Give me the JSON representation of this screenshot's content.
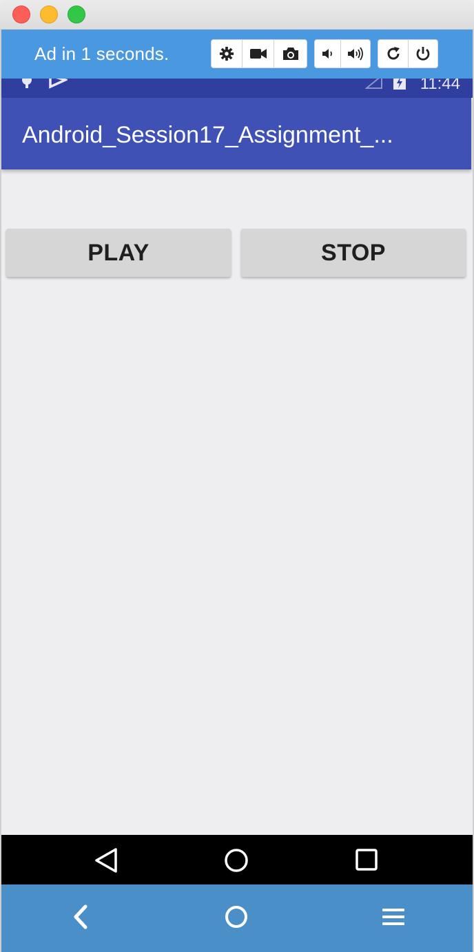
{
  "window": {
    "controls": [
      "close",
      "minimize",
      "zoom"
    ]
  },
  "toolbar": {
    "ad_text": "Ad in 1 seconds.",
    "buttons": [
      "gear-icon",
      "video-icon",
      "camera-icon",
      "volume-down-icon",
      "volume-up-icon",
      "rotate-icon",
      "power-icon"
    ]
  },
  "statusbar": {
    "time": "11:44"
  },
  "app": {
    "title": "Android_Session17_Assignment_...",
    "play_label": "PLAY",
    "stop_label": "STOP"
  },
  "android_nav": [
    "back-triangle-icon",
    "home-circle-icon",
    "recents-square-icon"
  ],
  "bottom_nav": [
    "chevron-left-icon",
    "home-circle-icon",
    "menu-icon"
  ],
  "colors": {
    "toolbar": "#4a98e0",
    "status_bar": "#303f9f",
    "app_bar": "#3f51b5",
    "button": "#d6d6d6",
    "bottom_bar": "#4b8fc9"
  }
}
